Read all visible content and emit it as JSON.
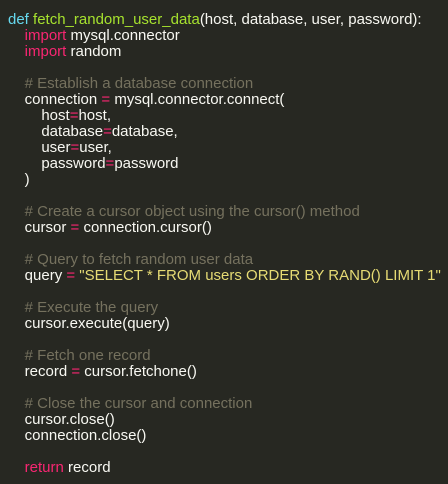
{
  "code": {
    "lines": [
      [
        "def",
        " ",
        "fetch_random_user_data",
        "(host, database, user, password):"
      ],
      [
        "    import",
        " mysql.connector"
      ],
      [
        "    import",
        " random"
      ],
      [
        ""
      ],
      [
        "    # Establish a database connection"
      ],
      [
        "    connection ",
        "=",
        " mysql.connector.connect("
      ],
      [
        "        host",
        "=",
        "host,"
      ],
      [
        "        database",
        "=",
        "database,"
      ],
      [
        "        user",
        "=",
        "user,"
      ],
      [
        "        password",
        "=",
        "password"
      ],
      [
        "    )"
      ],
      [
        ""
      ],
      [
        "    # Create a cursor object using the cursor() method"
      ],
      [
        "    cursor ",
        "=",
        " connection.cursor()"
      ],
      [
        ""
      ],
      [
        "    # Query to fetch random user data"
      ],
      [
        "    query ",
        "=",
        " ",
        "\"SELECT * FROM users ORDER BY RAND() LIMIT 1\""
      ],
      [
        ""
      ],
      [
        "    # Execute the query"
      ],
      [
        "    cursor.execute(query)"
      ],
      [
        ""
      ],
      [
        "    # Fetch one record"
      ],
      [
        "    record ",
        "=",
        " cursor.fetchone()"
      ],
      [
        ""
      ],
      [
        "    # Close the cursor and connection"
      ],
      [
        "    cursor.close()"
      ],
      [
        "    connection.close()"
      ],
      [
        ""
      ],
      [
        "    return",
        " record"
      ]
    ]
  }
}
